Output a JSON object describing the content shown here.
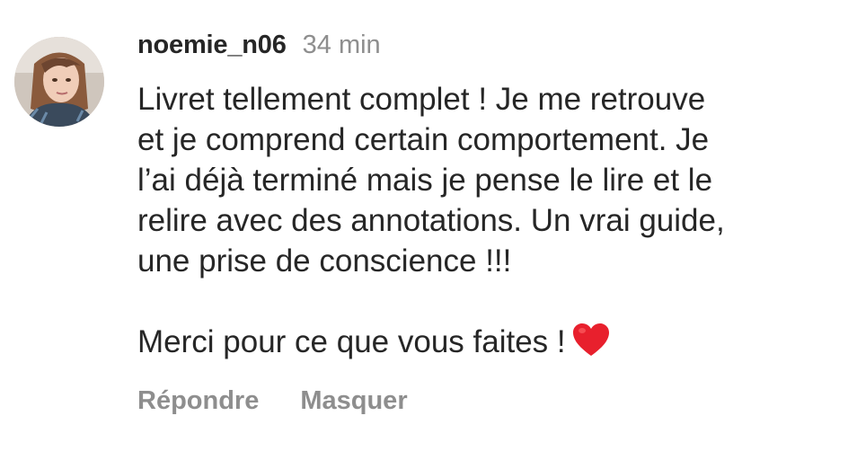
{
  "comment": {
    "username": "noemie_n06",
    "timestamp": "34 min",
    "lines": [
      "Livret tellement complet ! Je me retrouve",
      "et je comprend certain comportement. Je",
      "l’ai déjà terminé mais je pense le lire et le",
      "relire avec des annotations. Un vrai guide,",
      "une prise de conscience !!!"
    ],
    "closing": "Merci pour ce que vous faites !",
    "closing_icon": "red-heart-icon",
    "heart_color": "#e8202d"
  },
  "actions": {
    "reply_label": "Répondre",
    "hide_label": "Masquer"
  }
}
